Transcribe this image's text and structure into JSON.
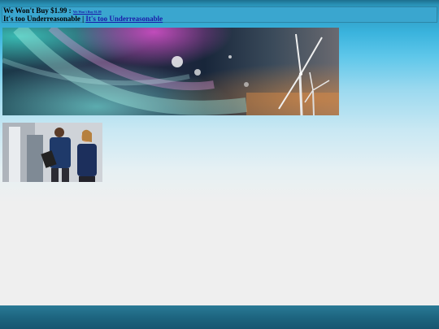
{
  "header": {
    "title": "We Won't Buy $1.99",
    "separator": " : ",
    "title_link": "We Won't Buy $1.99",
    "subtitle": "It's too Underreasonable",
    "pipe": " | ",
    "subtitle_link": "It's too Underreasonable"
  },
  "colors": {
    "header_bg": "#3aa6cf",
    "link": "#1a1aa8",
    "footer": "#1d6580"
  }
}
